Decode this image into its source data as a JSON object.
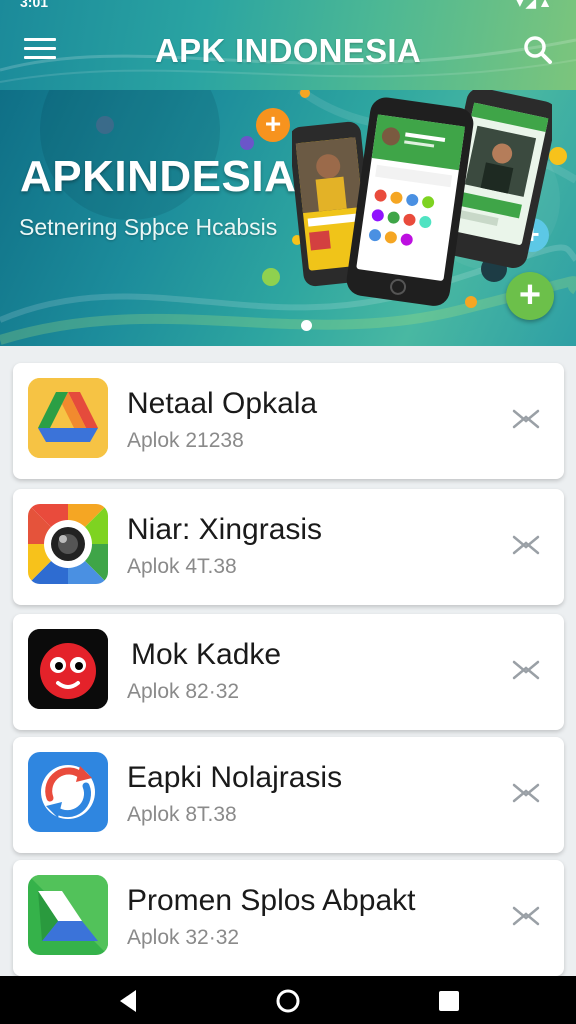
{
  "status_bar": {
    "time": "3:01",
    "icons": "▾◢▲"
  },
  "header": {
    "title": "APK INDONESIA",
    "menu_icon": "menu-icon",
    "search_icon": "search-icon"
  },
  "banner": {
    "title": "APKINDESIA",
    "subtitle": "Setnering Spþce Hcabsis",
    "plus_icon": "plus-icon"
  },
  "apps": [
    {
      "name": "Netaal Opkala",
      "meta": "Aplok 21238",
      "icon": "triangle-logo-icon"
    },
    {
      "name": "Niar: Xingrasis",
      "meta": "Aplok 4T.38",
      "icon": "camera-gear-icon"
    },
    {
      "name": "Mok Kadke",
      "meta": "Aplok 82·32",
      "icon": "red-face-icon"
    },
    {
      "name": "Eapki Nolajrasis",
      "meta": "Aplok 8T.38",
      "icon": "refresh-arrow-icon"
    },
    {
      "name": "Promen Splos Abpakt",
      "meta": "Aplok 32·32",
      "icon": "chevron-logo-icon"
    }
  ],
  "nav": {
    "back": "back-icon",
    "home": "home-icon",
    "recents": "recents-icon"
  },
  "colors": {
    "accent": "#2aa4a2",
    "fab_green": "#6cc04a",
    "fab_orange": "#f7931e"
  }
}
